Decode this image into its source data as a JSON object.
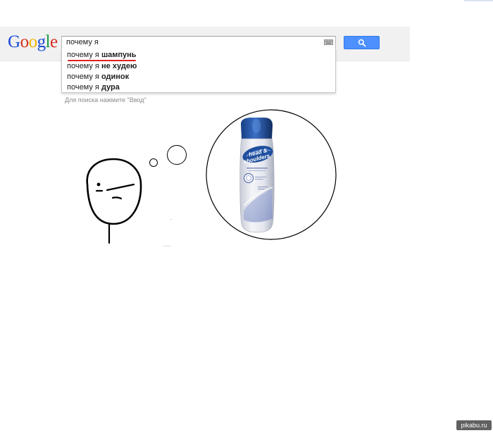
{
  "logo": {
    "letters": [
      "G",
      "o",
      "o",
      "g",
      "l",
      "e"
    ],
    "colors": [
      "#1a4bd6",
      "#d62d20",
      "#f0b400",
      "#1a4bd6",
      "#189a3a",
      "#d62d20"
    ]
  },
  "search": {
    "value": "почему я",
    "button_icon": "search-icon",
    "keyboard_icon": "keyboard-icon"
  },
  "suggestions": [
    {
      "prefix": "почему я ",
      "completion": "шампунь"
    },
    {
      "prefix": "почему я ",
      "completion": "не худею"
    },
    {
      "prefix": "почему я ",
      "completion": "одинок"
    },
    {
      "prefix": "почему я ",
      "completion": "дура"
    }
  ],
  "hint": "Для поиска нажмите \"Ввод\"",
  "bottle": {
    "brand_line1": "head &",
    "brand_line2": "shoulders"
  },
  "watermark": "pikabu.ru",
  "colors": {
    "accent_blue": "#4d90fe",
    "underline_red": "#e02020",
    "bottle_blue": "#1f4f9e"
  }
}
